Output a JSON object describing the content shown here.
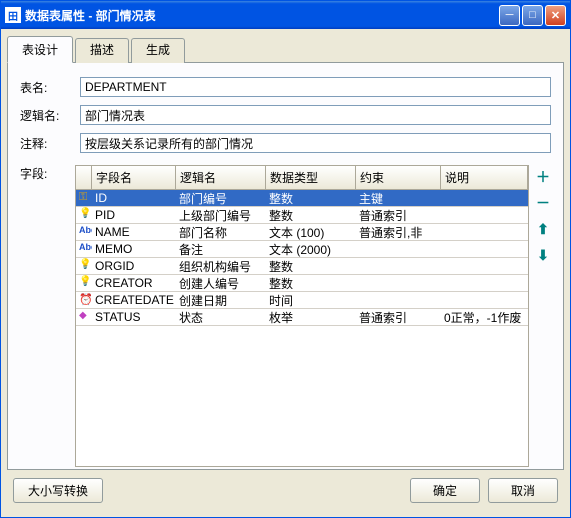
{
  "window": {
    "title": "数据表属性 - 部门情况表",
    "icon": "田"
  },
  "tabs": [
    {
      "label": "表设计",
      "active": true
    },
    {
      "label": "描述",
      "active": false
    },
    {
      "label": "生成",
      "active": false
    }
  ],
  "form": {
    "name_label": "表名:",
    "name_value": "DEPARTMENT",
    "logic_label": "逻辑名:",
    "logic_value": "部门情况表",
    "comment_label": "注释:",
    "comment_value": "按层级关系记录所有的部门情况",
    "fields_label": "字段:"
  },
  "columns": {
    "field": "字段名",
    "logic": "逻辑名",
    "type": "数据类型",
    "constraint": "约束",
    "desc": "说明"
  },
  "rows": [
    {
      "icon": "key",
      "field": "ID",
      "logic": "部门编号",
      "type": "整数",
      "constraint": "主键",
      "desc": "",
      "selected": true
    },
    {
      "icon": "bulb",
      "field": "PID",
      "logic": "上级部门编号",
      "type": "整数",
      "constraint": "普通索引",
      "desc": ""
    },
    {
      "icon": "abc",
      "field": "NAME",
      "logic": "部门名称",
      "type": "文本 (100)",
      "constraint": "普通索引,非",
      "desc": ""
    },
    {
      "icon": "abc",
      "field": "MEMO",
      "logic": "备注",
      "type": "文本 (2000)",
      "constraint": "",
      "desc": ""
    },
    {
      "icon": "bulb",
      "field": "ORGID",
      "logic": "组织机构编号",
      "type": "整数",
      "constraint": "",
      "desc": ""
    },
    {
      "icon": "bulb",
      "field": "CREATOR",
      "logic": "创建人编号",
      "type": "整数",
      "constraint": "",
      "desc": ""
    },
    {
      "icon": "clock",
      "field": "CREATEDATE",
      "logic": "创建日期",
      "type": "时间",
      "constraint": "",
      "desc": ""
    },
    {
      "icon": "diamond",
      "field": "STATUS",
      "logic": "状态",
      "type": "枚举",
      "constraint": "普通索引",
      "desc": "0正常，-1作废"
    }
  ],
  "arrows": {
    "add": "＋",
    "remove": "－",
    "up": "⬆",
    "down": "⬇"
  },
  "footer": {
    "case": "大小写转换",
    "ok": "确定",
    "cancel": "取消"
  }
}
